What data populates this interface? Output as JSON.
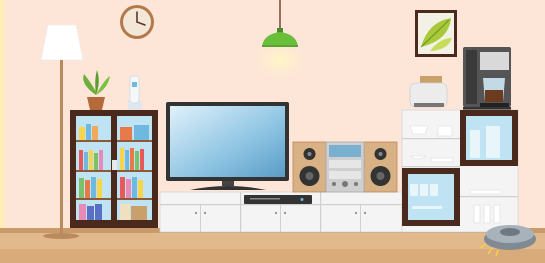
{
  "scene": {
    "kind": "living-room-illustration",
    "palette": {
      "wall": "#fde5d8",
      "floor": "#e2b98d",
      "floor_edge": "#c99a6a",
      "cabinet_dark": "#4a2a1c",
      "cabinet_white": "#f4f4f4",
      "glass": "#bfe3f3",
      "tv_screen": "#8fc8e6",
      "speaker_wood": "#d8b184",
      "lamp_green": "#6abf3a",
      "lamp_glow": "#fff6b0"
    },
    "objects": [
      "wall-clock",
      "floor-lamp",
      "pendant-lamp",
      "framed-plant-picture",
      "coffee-maker",
      "toaster",
      "potted-plant",
      "cordless-phone",
      "bookshelf-cabinet",
      "flat-screen-tv",
      "tv-stand",
      "dvd-player",
      "stereo-system",
      "left-speaker",
      "right-speaker",
      "display-cabinet",
      "robot-vacuum"
    ]
  }
}
